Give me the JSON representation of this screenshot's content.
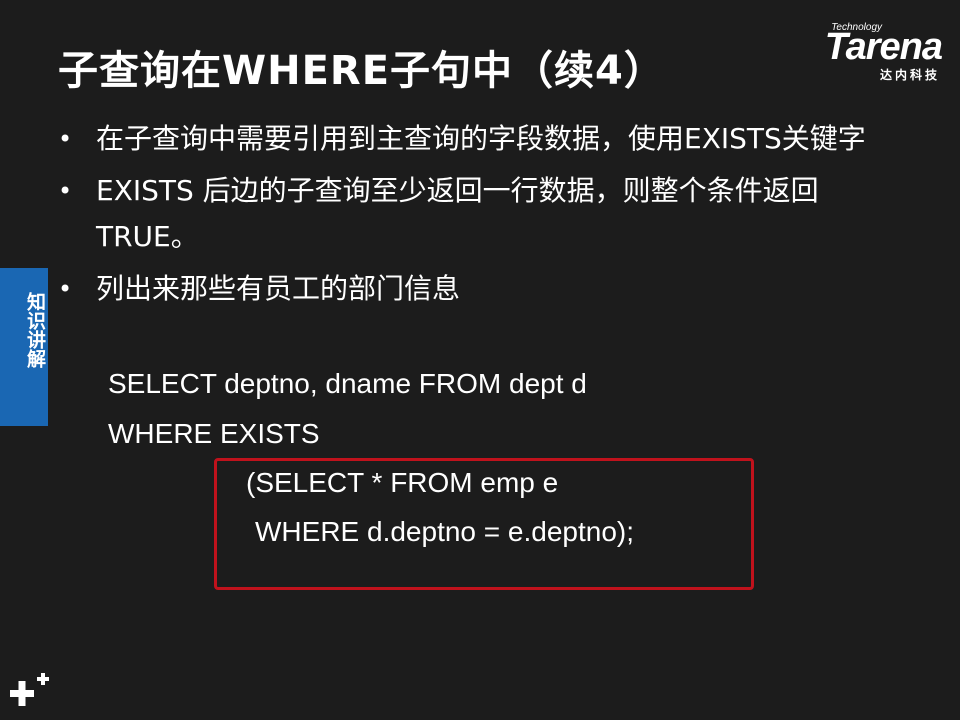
{
  "slide": {
    "title": "子查询在WHERE子句中（续4）",
    "logo": {
      "tagline": "Technology",
      "wordmark": "Tarena",
      "cn_name": "达内科技"
    },
    "bullets": [
      {
        "text": "在子查询中需要引用到主查询的字段数据，使用EXISTS关键字"
      },
      {
        "text": "EXISTS 后边的子查询至少返回一行数据，则整个条件返回TRUE。"
      },
      {
        "text": "列出来那些有员工的部门信息"
      }
    ],
    "code_lines": [
      "SELECT deptno, dname FROM dept d",
      "WHERE EXISTS",
      "(SELECT * FROM emp e",
      "WHERE d.deptno = e.deptno);"
    ],
    "side_tab": "知识讲解",
    "colors": {
      "background": "#1c1c1c",
      "highlight_border": "#c0121c",
      "side_tab": "#1a67b3"
    },
    "icons": [
      "bullet-icon",
      "plus-icon"
    ]
  }
}
